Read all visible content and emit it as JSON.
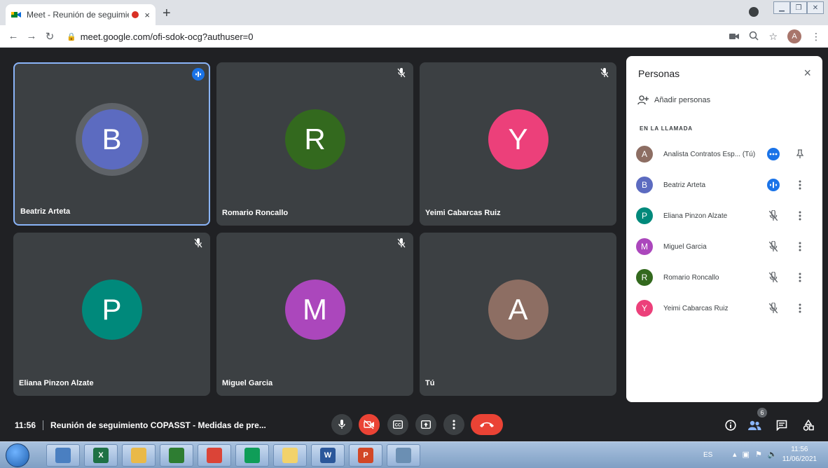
{
  "browser": {
    "tab_title": "Meet - Reunión de seguimie",
    "tab_close": "×",
    "new_tab": "+",
    "url": "meet.google.com/ofi-sdok-ocg?authuser=0",
    "profile_initial": "A"
  },
  "tiles": [
    {
      "name": "Beatriz Arteta",
      "initial": "B",
      "color": "#5c6bc0",
      "state": "speaking"
    },
    {
      "name": "Romario Roncallo",
      "initial": "R",
      "color": "#33691e",
      "state": "muted"
    },
    {
      "name": "Yeimi Cabarcas Ruiz",
      "initial": "Y",
      "color": "#ec407a",
      "state": "muted"
    },
    {
      "name": "Eliana Pinzon Alzate",
      "initial": "P",
      "color": "#00897b",
      "state": "muted"
    },
    {
      "name": "Miguel Garcia",
      "initial": "M",
      "color": "#ab47bc",
      "state": "muted"
    },
    {
      "name": "Tú",
      "initial": "A",
      "color": "#8d6e63",
      "state": "none"
    }
  ],
  "panel": {
    "title": "Personas",
    "close": "×",
    "add_people": "Añadir personas",
    "section": "EN LA LLAMADA",
    "people": [
      {
        "name": "Analista Contratos Esp... (Tú)",
        "initial": "A",
        "color": "#8d6e63",
        "state": "more-dots"
      },
      {
        "name": "Beatriz Arteta",
        "initial": "B",
        "color": "#5c6bc0",
        "state": "speaking"
      },
      {
        "name": "Eliana Pinzon Alzate",
        "initial": "P",
        "color": "#00897b",
        "state": "muted"
      },
      {
        "name": "Miguel Garcia",
        "initial": "M",
        "color": "#ab47bc",
        "state": "muted"
      },
      {
        "name": "Romario Roncallo",
        "initial": "R",
        "color": "#33691e",
        "state": "muted"
      },
      {
        "name": "Yeimi Cabarcas Ruiz",
        "initial": "Y",
        "color": "#ec407a",
        "state": "muted"
      }
    ]
  },
  "bottom": {
    "time": "11:56",
    "meeting_title": "Reunión de seguimiento COPASST - Medidas de pre...",
    "participant_count": "6"
  },
  "taskbar": {
    "lang": "ES",
    "time": "11:56",
    "date": "11/06/2021",
    "apps": [
      {
        "icon": "network-icon",
        "label": "",
        "color": "#4a7fc1"
      },
      {
        "icon": "excel-icon",
        "label": "X",
        "color": "#1e7145"
      },
      {
        "icon": "explorer-icon",
        "label": "",
        "color": "#e9b949"
      },
      {
        "icon": "meet-app-icon",
        "label": "",
        "color": "#2e7d32"
      },
      {
        "icon": "chrome-icon",
        "label": "",
        "color": "#db4437"
      },
      {
        "icon": "chrome-icon",
        "label": "",
        "color": "#0f9d58"
      },
      {
        "icon": "folder-icon",
        "label": "",
        "color": "#f2d26b"
      },
      {
        "icon": "word-icon",
        "label": "W",
        "color": "#2b579a"
      },
      {
        "icon": "powerpoint-icon",
        "label": "P",
        "color": "#d24726"
      },
      {
        "icon": "calculator-icon",
        "label": "",
        "color": "#6b8fb3"
      }
    ]
  }
}
